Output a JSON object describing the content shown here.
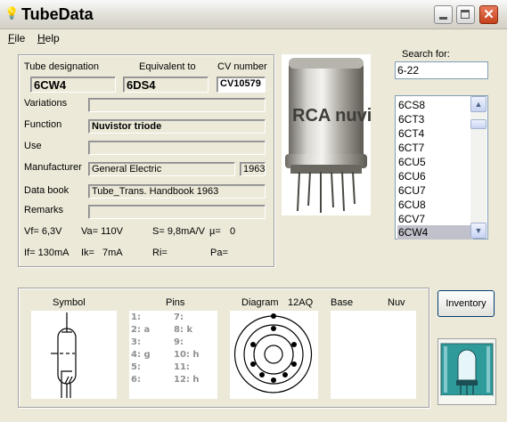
{
  "window": {
    "title": "TubeData"
  },
  "menu": {
    "file": "File",
    "help": "Help"
  },
  "fields": {
    "tube_designation_label": "Tube designation",
    "tube_designation": "6CW4",
    "equivalent_label": "Equivalent to",
    "equivalent": "6DS4",
    "cv_label": "CV number",
    "cv": "CV10579",
    "variations_label": "Variations",
    "variations": "",
    "function_label": "Function",
    "function": "Nuvistor triode",
    "use_label": "Use",
    "use": "",
    "manufacturer_label": "Manufacturer",
    "manufacturer": "General Electric",
    "year": "1963",
    "databook_label": "Data book",
    "databook": "Tube_Trans. Handbook 1963",
    "remarks_label": "Remarks",
    "remarks": ""
  },
  "params": {
    "vf": "Vf= 6,3V",
    "va": "Va= 110V",
    "s": "S= 9,8mA/V",
    "mu": "µ=",
    "mu_val": "0",
    "if": "If= 130mA",
    "ik": "Ik=",
    "ik_val": "7mA",
    "ri": "Ri=",
    "pa": "Pa="
  },
  "search": {
    "label": "Search for:",
    "value": "6-22"
  },
  "list": {
    "items": [
      "6CS8",
      "6CT3",
      "6CT4",
      "6CT7",
      "6CU5",
      "6CU6",
      "6CU7",
      "6CU8",
      "6CV7",
      "6CW4"
    ],
    "selected": "6CW4"
  },
  "panels": {
    "symbol": "Symbol",
    "pins": "Pins",
    "diagram": "Diagram",
    "diagram_code": "12AQ",
    "base": "Base",
    "base_type": "Nuv"
  },
  "pins": {
    "left": [
      "1:",
      "2: a",
      "3:",
      "4: g",
      "5:",
      "6:"
    ],
    "right": [
      "7:",
      "8: k",
      "9:",
      "10: h",
      "11:",
      "12: h"
    ]
  },
  "photo_label": "RCA nuvi",
  "buttons": {
    "inventory": "Inventory"
  },
  "colors": {
    "selection": "#c1c1cc",
    "close": "#c4411c"
  }
}
